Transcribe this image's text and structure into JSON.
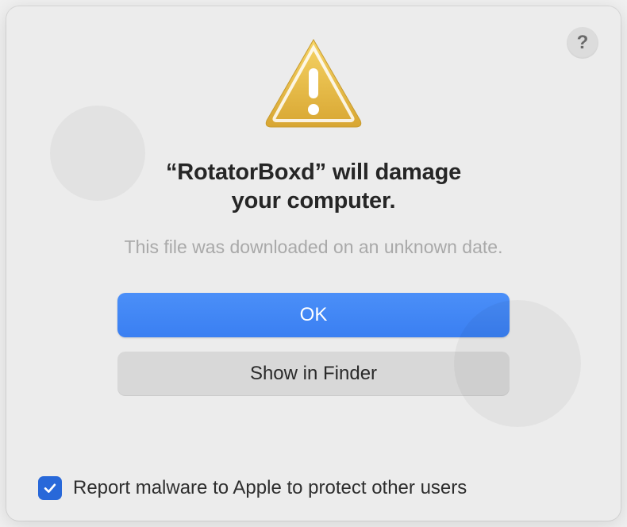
{
  "dialog": {
    "title_line1": "“RotatorBoxd” will damage",
    "title_line2": "your computer.",
    "subtitle": "This file was downloaded on an unknown date.",
    "help_glyph": "?"
  },
  "buttons": {
    "primary": "OK",
    "secondary": "Show in Finder"
  },
  "checkbox": {
    "checked": true,
    "label": "Report malware to Apple to protect other users"
  }
}
